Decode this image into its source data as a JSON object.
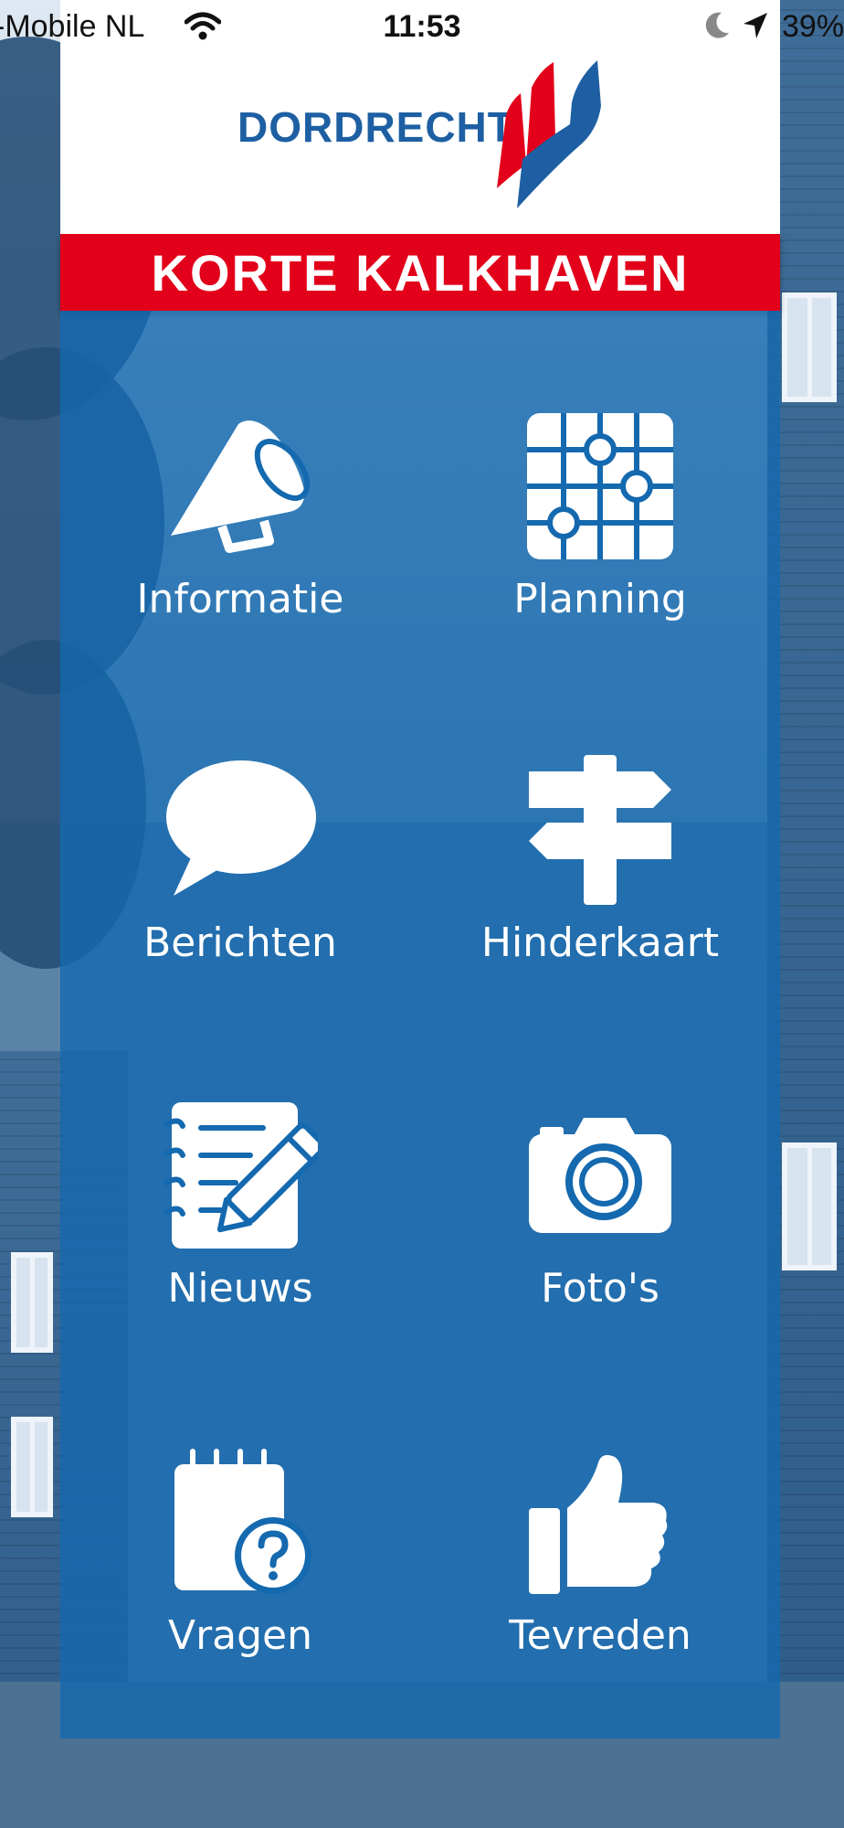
{
  "status_bar": {
    "carrier": "-Mobile NL",
    "time": "11:53",
    "battery": "39%"
  },
  "header": {
    "logo_text": "DORDRECHT",
    "banner_title": "KORTE KALKHAVEN"
  },
  "menu": [
    {
      "label": "Informatie",
      "icon": "megaphone-icon"
    },
    {
      "label": "Planning",
      "icon": "planning-grid-icon"
    },
    {
      "label": "Berichten",
      "icon": "speech-bubble-icon"
    },
    {
      "label": "Hinderkaart",
      "icon": "signpost-icon"
    },
    {
      "label": "Nieuws",
      "icon": "notepad-pencil-icon"
    },
    {
      "label": "Foto's",
      "icon": "camera-icon"
    },
    {
      "label": "Vragen",
      "icon": "question-notepad-icon"
    },
    {
      "label": "Tevreden",
      "icon": "thumbs-up-icon"
    }
  ],
  "colors": {
    "brand_blue": "#1d5fa2",
    "banner_red": "#e2001a",
    "tile_overlay": "#1469af"
  }
}
